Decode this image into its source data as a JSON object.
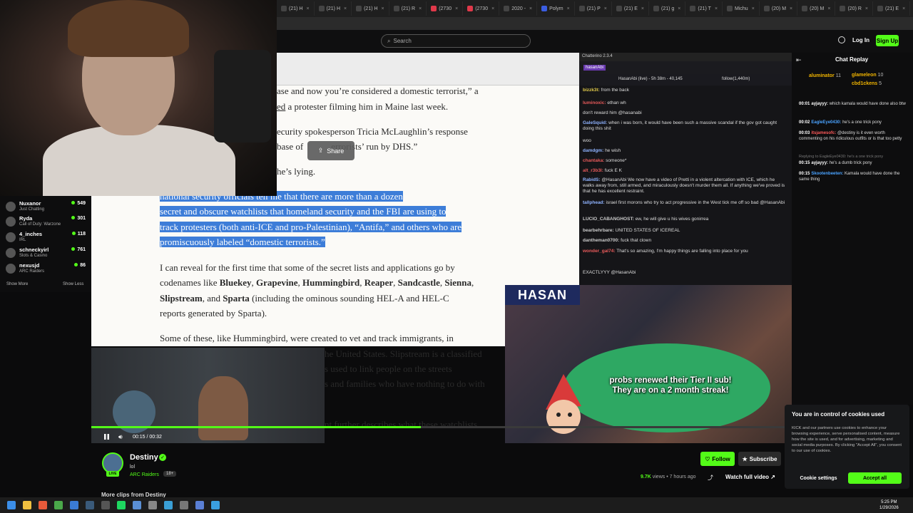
{
  "browser": {
    "tabs": [
      "(21) H",
      "(21) H",
      "(21) H",
      "(21) R",
      "(2730",
      "(2730",
      "2020 -",
      "Polym",
      "(21) P",
      "(21) E",
      "(21) g",
      "(21) T",
      "Michu",
      "(20) M",
      "(20) M",
      "(20) R",
      "(21) E"
    ]
  },
  "site": {
    "search_placeholder": "Search",
    "login_label": "Log In",
    "signup_label": "Sign Up"
  },
  "sidebar": {
    "items": [
      {
        "name": "Nuxanor",
        "game": "Just Chatting",
        "viewers": "549"
      },
      {
        "name": "Ryda",
        "game": "Call of Duty: Warzone",
        "viewers": "301"
      },
      {
        "name": "4_inches",
        "game": "IRL",
        "viewers": "118"
      },
      {
        "name": "schneckyirl",
        "game": "Slots & Casino",
        "viewers": "761"
      },
      {
        "name": "nexusjd",
        "game": "ARC Raiders",
        "viewers": "86"
      }
    ],
    "show_more": "Show More",
    "show_less": "Show Less"
  },
  "article": {
    "p1_line1": "ase and now you’re considered a domestic terrorist,” a",
    "p1_line2_a": "ed",
    "p1_line2_b": " a protester filming him in Maine last week.",
    "p2_line1": "ecurity spokesperson Tricia McLaughlin’s response",
    "p2_line2_a": "base of ",
    "p2_line2_b": "errorists’ run by DHS.”",
    "p3": "he’s lying.",
    "hl_line1": "national security officials tell me that there are more than a dozen",
    "hl_line2": "secret and obscure watchlists that homeland security and the FBI are using to",
    "hl_line3": "track protesters (both anti-ICE and pro-Palestinian), “Antifa,” and others who are",
    "hl_line4": "promiscuously labeled “domestic terrorists.”",
    "p5_line1": "I can reveal for the first time that some of the secret lists and applications go by",
    "p5_line2_a": "codenames like ",
    "p5_line2_b": "Bluekey",
    "p5_line2_c": ", ",
    "p5_line2_d": "Grapevine",
    "p5_line2_e": ", ",
    "p5_line2_f": "Hummingbird",
    "p5_line2_g": ", ",
    "p5_line2_h": "Reaper",
    "p5_line2_i": ", ",
    "p5_line2_j": "Sandcastle",
    "p5_line2_k": ", ",
    "p5_line2_l": "Sienna",
    "p5_line2_m": ",",
    "p5_line3_a": "Slipstream",
    "p5_line3_b": ", and ",
    "p5_line3_c": "Sparta",
    "p5_line3_d": " (including the ominous sounding HEL-A and HEL-C",
    "p5_line4": "reports generated by Sparta).",
    "p6_line1": "Some of these, like Hummingbird, were created to vet and track immigrants, in",
    "p6_line2": "he United States. Slipstream is a classified",
    "p6_line3": "s used to link people on the streets",
    "p6_line4": "s and families who have nothing to do with",
    "p6_line5": "nt further describes what these watchlists",
    "share_label": "Share"
  },
  "chatterino": {
    "title": "Chatterino 2.3.4",
    "channel_tab": "hasanAbi",
    "status": "HasanAbi (live) - 5h 38m - 40,145",
    "follow": "follow(1,440m)",
    "messages": [
      {
        "user": "bizzk3t:",
        "text": "from the back",
        "color": "#e0c94a"
      },
      {
        "user": "luminoxic:",
        "text": "ethan wh",
        "color": "#e85a5a"
      },
      {
        "user": "",
        "text": "don't reward him @hasanabi",
        "color": "#e85a5a"
      },
      {
        "user": "GaleSquid:",
        "text": "when i was born, it would have been such a massive scandal if the gov got caught doing this shit",
        "color": "#8fb3ff"
      },
      {
        "user": "",
        "text": "woo",
        "color": "#e85a5a"
      },
      {
        "user": "damdgm:",
        "text": "he wish",
        "color": "#8fb3ff"
      },
      {
        "user": "chantaka:",
        "text": "someone*",
        "color": "#e85a5a"
      },
      {
        "user": "alt_r3b3l:",
        "text": "fuck E K",
        "color": "#e85a5a"
      },
      {
        "user": "RabidS:",
        "text": "@HasanAbi We now have a video of Pretti in a violent altercation with ICE, which he walks away from, still armed, and miraculously doesn't murder them all. If anything we've proved is that he has excellent restraint.",
        "color": "#8fb3ff"
      },
      {
        "user": "tallphead:",
        "text": "israel first morons who try to act progressive in the West tick me off so bad @HasanAbi",
        "color": "#8fb3ff"
      },
      {
        "user": "LUCIO_CABANGHOST:",
        "text": "ew, he will give u his wives gonirrea",
        "color": "#cccccc"
      },
      {
        "user": "bearbehrbare:",
        "text": "UNITED STATES OF ICEREAL",
        "color": "#cccccc"
      },
      {
        "user": "dantheman0700:",
        "text": "fuck that clown",
        "color": "#cccccc"
      },
      {
        "user": "wonder_gal74:",
        "text": "That's so amazing, I'm happy things are falling into place for you",
        "color": "#e85a5a"
      },
      {
        "user": "",
        "text": "EXACTLYYY @HasanAbi",
        "color": "#e0c94a"
      }
    ]
  },
  "hasan": {
    "banner": "HASAN",
    "alert": "probs renewed their Tier II sub! They are on a 2 month streak!"
  },
  "player": {
    "time": "00:15 / 00:32",
    "progress": 0.47
  },
  "clip": {
    "channel": "Destiny",
    "title": "lol",
    "category": "ARC Raiders",
    "age_badge": "18+",
    "live_badge": "LIVE",
    "follow_label": "Follow",
    "subscribe_label": "Subscribe",
    "views_count": "9.7K",
    "views_rest": " views • 7 hours ago",
    "watch_full": "Watch full video",
    "more_clips": "More clips from Destiny"
  },
  "chat_replay": {
    "title": "Chat Replay",
    "top_gifters": [
      {
        "name": "aluminator",
        "count": "11"
      },
      {
        "name": "glameleon",
        "count": "10"
      },
      {
        "name": "cbd1ckens",
        "count": "5"
      }
    ],
    "messages": [
      {
        "time": "00:01",
        "user": "ayjayyy:",
        "text": "which kamala would have done also btw",
        "color": "#ffffff"
      },
      {
        "time": "00:02",
        "user": "EagleEye0430:",
        "text": "he's a one trick pony",
        "color": "#4aa3ff"
      },
      {
        "time": "00:03",
        "user": "itsjamesofc:",
        "text": "@destiny is it even worth commenting on his ridiculous outfits or is that too petty",
        "color": "#ff5a5a"
      },
      {
        "time": "00:15",
        "user": "ayjayyy:",
        "text": "he's a dumb trick pony",
        "color": "#ffffff"
      },
      {
        "time": "00:15",
        "user": "Skootenbeeten:",
        "text": "Kamala would have done the same thing",
        "color": "#4aa3ff"
      }
    ],
    "reply_hint": "Replying to EagleEye0430: he's a one trick pony"
  },
  "cookie": {
    "title": "You are in control of cookies used",
    "body": "KICK and our partners use cookies to enhance your browsing experience, serve personalised content, measure how the site is used, and for advertising, marketing and social media purposes. By clicking \"Accept All\", you consent to our use of cookies.",
    "settings_label": "Cookie settings",
    "accept_label": "Accept all"
  },
  "taskbar": {
    "time": "5:25 PM",
    "date": "1/29/2026"
  },
  "colors": {
    "accent": "#53fc18",
    "highlight": "#3d7dd8"
  }
}
